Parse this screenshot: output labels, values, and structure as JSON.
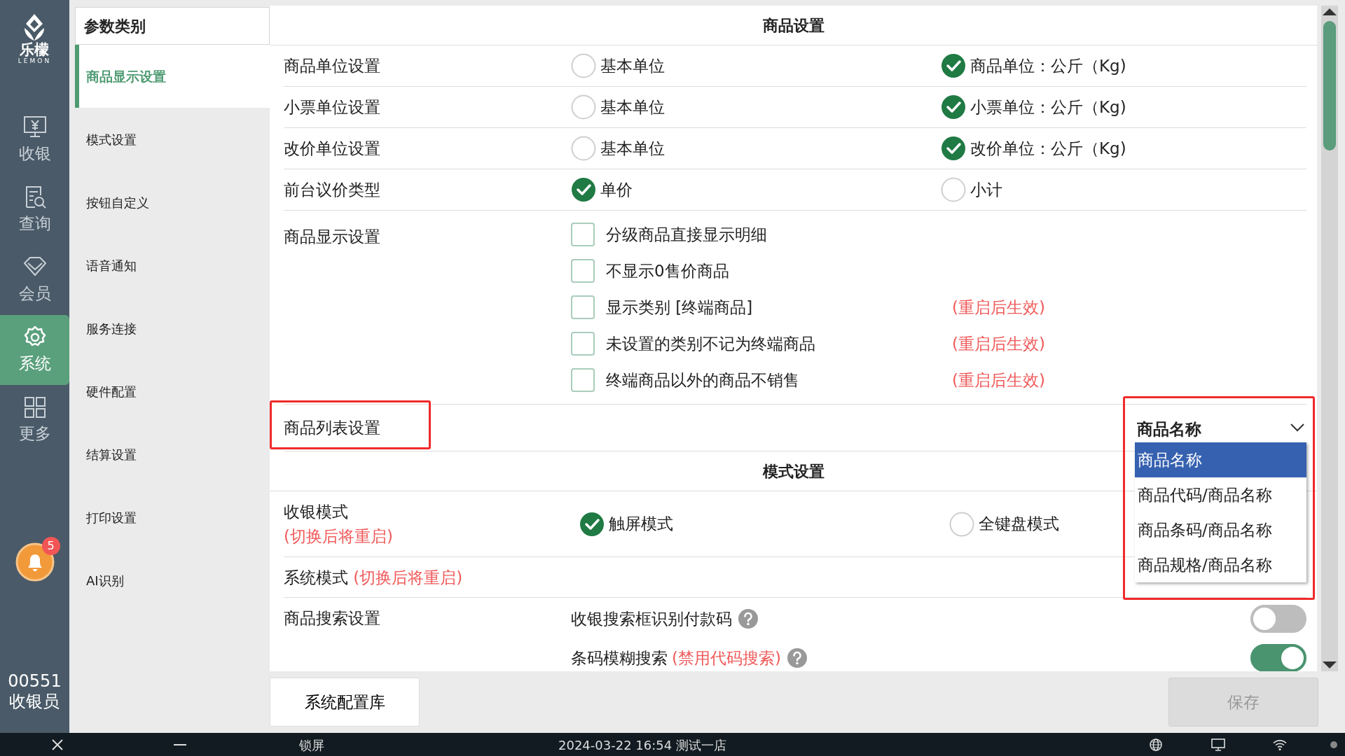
{
  "rail": {
    "logo_title": "乐檬",
    "logo_subtitle": "LEMON",
    "items": [
      {
        "kind": "register",
        "label": "收银",
        "selected": false
      },
      {
        "kind": "query",
        "label": "查询",
        "selected": false
      },
      {
        "kind": "member",
        "label": "会员",
        "selected": false
      },
      {
        "kind": "system",
        "label": "系统",
        "selected": true
      },
      {
        "kind": "more",
        "label": "更多",
        "selected": false
      }
    ],
    "notification_count": "5",
    "user_code": "00551",
    "user_role": "收银员"
  },
  "categories": {
    "title": "参数类别",
    "items": [
      {
        "label": "商品显示设置",
        "selected": true
      },
      {
        "label": "模式设置",
        "selected": false
      },
      {
        "label": "按钮自定义",
        "selected": false
      },
      {
        "label": "语音通知",
        "selected": false
      },
      {
        "label": "服务连接",
        "selected": false
      },
      {
        "label": "硬件配置",
        "selected": false
      },
      {
        "label": "结算设置",
        "selected": false
      },
      {
        "label": "打印设置",
        "selected": false
      },
      {
        "label": "AI识别",
        "selected": false
      }
    ]
  },
  "sections": [
    {
      "title": "商品设置",
      "rows": [
        {
          "kind": "radio",
          "label": "商品单位设置",
          "options": [
            {
              "label": "基本单位",
              "selected": false
            },
            {
              "label": "商品单位：公斤（Kg)",
              "selected": true
            }
          ]
        },
        {
          "kind": "radio",
          "label": "小票单位设置",
          "options": [
            {
              "label": "基本单位",
              "selected": false
            },
            {
              "label": "小票单位：公斤（Kg)",
              "selected": true
            }
          ]
        },
        {
          "kind": "radio",
          "label": "改价单位设置",
          "options": [
            {
              "label": "基本单位",
              "selected": false
            },
            {
              "label": "改价单位：公斤（Kg)",
              "selected": true
            }
          ]
        },
        {
          "kind": "radio",
          "label": "前台议价类型",
          "options": [
            {
              "label": "单价",
              "selected": true
            },
            {
              "label": "小计",
              "selected": false
            }
          ]
        },
        {
          "kind": "checks",
          "label": "商品显示设置",
          "items": [
            {
              "label": "分级商品直接显示明细",
              "checked": false
            },
            {
              "label": "不显示0售价商品",
              "checked": false
            },
            {
              "label": "显示类别 [终端商品]",
              "checked": false,
              "note": "(重启后生效)"
            },
            {
              "label": "未设置的类别不记为终端商品",
              "checked": false,
              "note": "(重启后生效)"
            },
            {
              "label": "终端商品以外的商品不销售",
              "checked": false,
              "note": "(重启后生效)"
            }
          ]
        },
        {
          "kind": "select",
          "label": "商品列表设置",
          "value": "商品名称",
          "highlighted": true,
          "open": true,
          "options": [
            {
              "label": "商品名称",
              "selected": true
            },
            {
              "label": "商品代码/商品名称",
              "selected": false
            },
            {
              "label": "商品条码/商品名称",
              "selected": false
            },
            {
              "label": "商品规格/商品名称",
              "selected": false
            }
          ]
        }
      ]
    },
    {
      "title": "模式设置",
      "rows": [
        {
          "kind": "radio",
          "label": "收银模式",
          "note": "(切换后将重启)",
          "options": [
            {
              "label": "触屏模式",
              "selected": true
            },
            {
              "label": "全键盘模式",
              "selected": false
            }
          ]
        },
        {
          "kind": "text",
          "label": "系统模式",
          "note": "(切换后将重启)"
        },
        {
          "kind": "toggles",
          "label": "商品搜索设置",
          "items": [
            {
              "label": "收银搜索框识别付款码",
              "on": false
            },
            {
              "label": "条码模糊搜索",
              "note": "(禁用代码搜索)",
              "on": true
            }
          ]
        }
      ]
    }
  ],
  "footer": {
    "config_button": "系统配置库",
    "save_button": "保存",
    "save_disabled": true
  },
  "taskbar": {
    "lock": "锁屏",
    "datetime": "2024-03-22 16:54 测试一店"
  }
}
